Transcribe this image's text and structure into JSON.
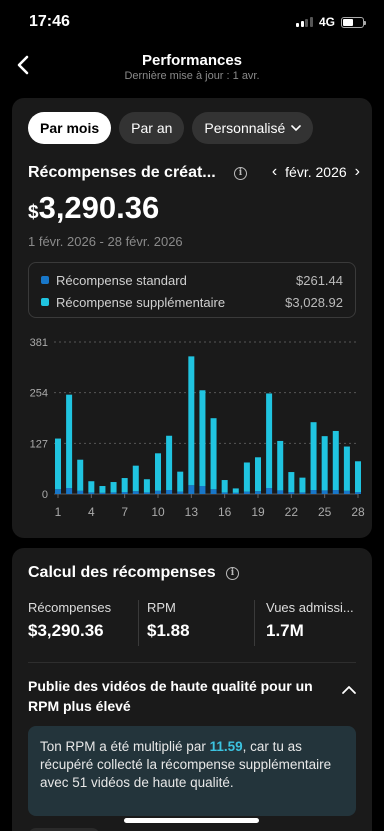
{
  "status": {
    "time": "17:46",
    "network": "4G"
  },
  "header": {
    "title": "Performances",
    "subtitle": "Dernière mise à jour : 1 avr."
  },
  "filters": {
    "month": "Par mois",
    "year": "Par an",
    "custom": "Personnalisé"
  },
  "rewards": {
    "title": "Récompenses de créat...",
    "month": "févr. 2026",
    "currency": "$",
    "amount": "3,290.36",
    "period": "1 févr. 2026 - 28 févr. 2026",
    "legend": [
      {
        "label": "Récompense standard",
        "value": "$261.44",
        "color": "#1877c9"
      },
      {
        "label": "Récompense supplémentaire",
        "value": "$3,028.92",
        "color": "#20c4e0"
      }
    ]
  },
  "chart_data": {
    "type": "bar",
    "stacked": true,
    "categories": [
      1,
      2,
      3,
      4,
      5,
      6,
      7,
      8,
      9,
      10,
      11,
      12,
      13,
      14,
      15,
      16,
      17,
      18,
      19,
      20,
      21,
      22,
      23,
      24,
      25,
      26,
      27,
      28
    ],
    "x_tick_labels": [
      "1",
      "4",
      "7",
      "10",
      "13",
      "16",
      "19",
      "22",
      "25",
      "28"
    ],
    "y_tick_labels": [
      "381",
      "254",
      "127",
      "0"
    ],
    "ylim": [
      0,
      381
    ],
    "series": [
      {
        "name": "Récompense standard",
        "color": "#1877c9",
        "values": [
          12,
          15,
          8,
          4,
          3,
          4,
          5,
          7,
          4,
          8,
          10,
          6,
          22,
          20,
          12,
          4,
          3,
          6,
          7,
          15,
          9,
          5,
          4,
          10,
          9,
          10,
          8,
          5
        ]
      },
      {
        "name": "Récompense supplémentaire",
        "color": "#20c4e0",
        "values": [
          127,
          234,
          78,
          28,
          17,
          26,
          35,
          64,
          33,
          94,
          136,
          50,
          323,
          240,
          178,
          31,
          11,
          73,
          85,
          237,
          124,
          50,
          37,
          170,
          136,
          148,
          111,
          77
        ]
      }
    ],
    "grid": true
  },
  "calc": {
    "title": "Calcul des récompenses",
    "stats": [
      {
        "label": "Récompenses",
        "value": "$3,290.36"
      },
      {
        "label": "RPM",
        "value": "$1.88"
      },
      {
        "label": "Vues admissi...",
        "value": "1.7M"
      }
    ],
    "high_quality_title": "Publie des vidéos de haute qualité pour un RPM plus élevé",
    "tip_before": "Ton RPM a été multiplié par ",
    "tip_multiplier": "11.59",
    "tip_after": ", car tu as récupéré collecté la récompense supplémentaire avec 51 vidéos de haute qualité."
  }
}
